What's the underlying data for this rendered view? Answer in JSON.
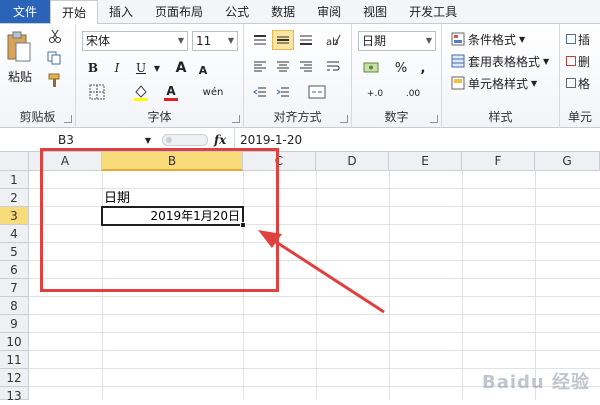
{
  "tabs": [
    "文件",
    "开始",
    "插入",
    "页面布局",
    "公式",
    "数据",
    "审阅",
    "视图",
    "开发工具"
  ],
  "ribbon": {
    "clipboard": {
      "label": "剪贴板",
      "paste": "粘贴"
    },
    "font": {
      "label": "字体",
      "name": "宋体",
      "size": "11",
      "bold": "B",
      "italic": "I",
      "underline": "U",
      "grow": "A",
      "shrink": "A",
      "color_letter": "A",
      "wen": "wén"
    },
    "alignment": {
      "label": "对齐方式"
    },
    "number": {
      "label": "数字",
      "format": "日期",
      "percent": "%",
      "comma": ",",
      "inc_dec": "+.0",
      "dec_dec": ".00"
    },
    "styles": {
      "label": "样式",
      "conditional": "条件格式",
      "table": "套用表格格式",
      "cell": "单元格样式"
    },
    "cells": {
      "label": "单元",
      "insert": "插",
      "delete": "删",
      "format": "格"
    }
  },
  "formula_bar": {
    "name_box": "B3",
    "fx": "fx",
    "value": "2019-1-20"
  },
  "grid": {
    "columns": [
      "A",
      "B",
      "C",
      "D",
      "E",
      "F",
      "G"
    ],
    "selected_column": "B",
    "rows": [
      "1",
      "2",
      "3",
      "4",
      "5",
      "6",
      "7",
      "8",
      "9",
      "10",
      "11",
      "12",
      "13"
    ],
    "selected_row": "3",
    "cells": {
      "B2": "日期",
      "B3": "2019年1月20日"
    }
  },
  "colors": {
    "file_tab": "#2a63b7",
    "annotation": "#e0403e",
    "selection_header": "#f9dc7a"
  },
  "watermark": "Baidu 经验"
}
